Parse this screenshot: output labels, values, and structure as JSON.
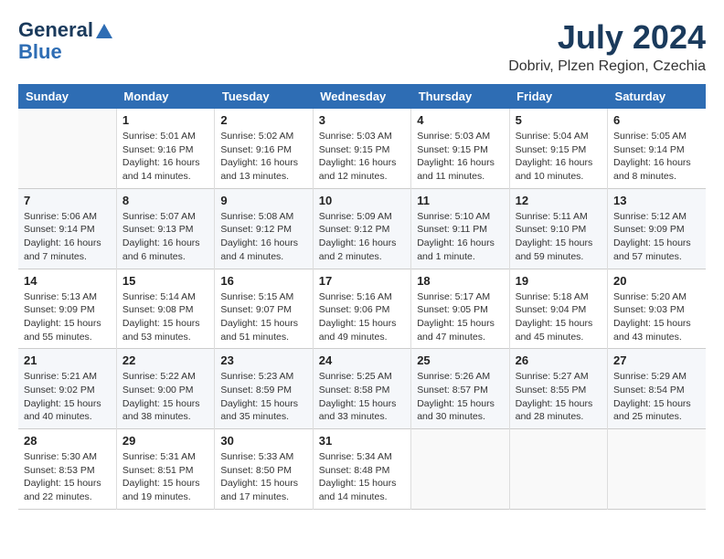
{
  "header": {
    "logo_line1": "General",
    "logo_line2": "Blue",
    "month": "July 2024",
    "location": "Dobriv, Plzen Region, Czechia"
  },
  "days_of_week": [
    "Sunday",
    "Monday",
    "Tuesday",
    "Wednesday",
    "Thursday",
    "Friday",
    "Saturday"
  ],
  "weeks": [
    [
      {
        "day": "",
        "sunrise": "",
        "sunset": "",
        "daylight": "",
        "empty": true
      },
      {
        "day": "1",
        "sunrise": "Sunrise: 5:01 AM",
        "sunset": "Sunset: 9:16 PM",
        "daylight": "Daylight: 16 hours and 14 minutes."
      },
      {
        "day": "2",
        "sunrise": "Sunrise: 5:02 AM",
        "sunset": "Sunset: 9:16 PM",
        "daylight": "Daylight: 16 hours and 13 minutes."
      },
      {
        "day": "3",
        "sunrise": "Sunrise: 5:03 AM",
        "sunset": "Sunset: 9:15 PM",
        "daylight": "Daylight: 16 hours and 12 minutes."
      },
      {
        "day": "4",
        "sunrise": "Sunrise: 5:03 AM",
        "sunset": "Sunset: 9:15 PM",
        "daylight": "Daylight: 16 hours and 11 minutes."
      },
      {
        "day": "5",
        "sunrise": "Sunrise: 5:04 AM",
        "sunset": "Sunset: 9:15 PM",
        "daylight": "Daylight: 16 hours and 10 minutes."
      },
      {
        "day": "6",
        "sunrise": "Sunrise: 5:05 AM",
        "sunset": "Sunset: 9:14 PM",
        "daylight": "Daylight: 16 hours and 8 minutes."
      }
    ],
    [
      {
        "day": "7",
        "sunrise": "Sunrise: 5:06 AM",
        "sunset": "Sunset: 9:14 PM",
        "daylight": "Daylight: 16 hours and 7 minutes."
      },
      {
        "day": "8",
        "sunrise": "Sunrise: 5:07 AM",
        "sunset": "Sunset: 9:13 PM",
        "daylight": "Daylight: 16 hours and 6 minutes."
      },
      {
        "day": "9",
        "sunrise": "Sunrise: 5:08 AM",
        "sunset": "Sunset: 9:12 PM",
        "daylight": "Daylight: 16 hours and 4 minutes."
      },
      {
        "day": "10",
        "sunrise": "Sunrise: 5:09 AM",
        "sunset": "Sunset: 9:12 PM",
        "daylight": "Daylight: 16 hours and 2 minutes."
      },
      {
        "day": "11",
        "sunrise": "Sunrise: 5:10 AM",
        "sunset": "Sunset: 9:11 PM",
        "daylight": "Daylight: 16 hours and 1 minute."
      },
      {
        "day": "12",
        "sunrise": "Sunrise: 5:11 AM",
        "sunset": "Sunset: 9:10 PM",
        "daylight": "Daylight: 15 hours and 59 minutes."
      },
      {
        "day": "13",
        "sunrise": "Sunrise: 5:12 AM",
        "sunset": "Sunset: 9:09 PM",
        "daylight": "Daylight: 15 hours and 57 minutes."
      }
    ],
    [
      {
        "day": "14",
        "sunrise": "Sunrise: 5:13 AM",
        "sunset": "Sunset: 9:09 PM",
        "daylight": "Daylight: 15 hours and 55 minutes."
      },
      {
        "day": "15",
        "sunrise": "Sunrise: 5:14 AM",
        "sunset": "Sunset: 9:08 PM",
        "daylight": "Daylight: 15 hours and 53 minutes."
      },
      {
        "day": "16",
        "sunrise": "Sunrise: 5:15 AM",
        "sunset": "Sunset: 9:07 PM",
        "daylight": "Daylight: 15 hours and 51 minutes."
      },
      {
        "day": "17",
        "sunrise": "Sunrise: 5:16 AM",
        "sunset": "Sunset: 9:06 PM",
        "daylight": "Daylight: 15 hours and 49 minutes."
      },
      {
        "day": "18",
        "sunrise": "Sunrise: 5:17 AM",
        "sunset": "Sunset: 9:05 PM",
        "daylight": "Daylight: 15 hours and 47 minutes."
      },
      {
        "day": "19",
        "sunrise": "Sunrise: 5:18 AM",
        "sunset": "Sunset: 9:04 PM",
        "daylight": "Daylight: 15 hours and 45 minutes."
      },
      {
        "day": "20",
        "sunrise": "Sunrise: 5:20 AM",
        "sunset": "Sunset: 9:03 PM",
        "daylight": "Daylight: 15 hours and 43 minutes."
      }
    ],
    [
      {
        "day": "21",
        "sunrise": "Sunrise: 5:21 AM",
        "sunset": "Sunset: 9:02 PM",
        "daylight": "Daylight: 15 hours and 40 minutes."
      },
      {
        "day": "22",
        "sunrise": "Sunrise: 5:22 AM",
        "sunset": "Sunset: 9:00 PM",
        "daylight": "Daylight: 15 hours and 38 minutes."
      },
      {
        "day": "23",
        "sunrise": "Sunrise: 5:23 AM",
        "sunset": "Sunset: 8:59 PM",
        "daylight": "Daylight: 15 hours and 35 minutes."
      },
      {
        "day": "24",
        "sunrise": "Sunrise: 5:25 AM",
        "sunset": "Sunset: 8:58 PM",
        "daylight": "Daylight: 15 hours and 33 minutes."
      },
      {
        "day": "25",
        "sunrise": "Sunrise: 5:26 AM",
        "sunset": "Sunset: 8:57 PM",
        "daylight": "Daylight: 15 hours and 30 minutes."
      },
      {
        "day": "26",
        "sunrise": "Sunrise: 5:27 AM",
        "sunset": "Sunset: 8:55 PM",
        "daylight": "Daylight: 15 hours and 28 minutes."
      },
      {
        "day": "27",
        "sunrise": "Sunrise: 5:29 AM",
        "sunset": "Sunset: 8:54 PM",
        "daylight": "Daylight: 15 hours and 25 minutes."
      }
    ],
    [
      {
        "day": "28",
        "sunrise": "Sunrise: 5:30 AM",
        "sunset": "Sunset: 8:53 PM",
        "daylight": "Daylight: 15 hours and 22 minutes."
      },
      {
        "day": "29",
        "sunrise": "Sunrise: 5:31 AM",
        "sunset": "Sunset: 8:51 PM",
        "daylight": "Daylight: 15 hours and 19 minutes."
      },
      {
        "day": "30",
        "sunrise": "Sunrise: 5:33 AM",
        "sunset": "Sunset: 8:50 PM",
        "daylight": "Daylight: 15 hours and 17 minutes."
      },
      {
        "day": "31",
        "sunrise": "Sunrise: 5:34 AM",
        "sunset": "Sunset: 8:48 PM",
        "daylight": "Daylight: 15 hours and 14 minutes."
      },
      {
        "day": "",
        "sunrise": "",
        "sunset": "",
        "daylight": "",
        "empty": true
      },
      {
        "day": "",
        "sunrise": "",
        "sunset": "",
        "daylight": "",
        "empty": true
      },
      {
        "day": "",
        "sunrise": "",
        "sunset": "",
        "daylight": "",
        "empty": true
      }
    ]
  ]
}
